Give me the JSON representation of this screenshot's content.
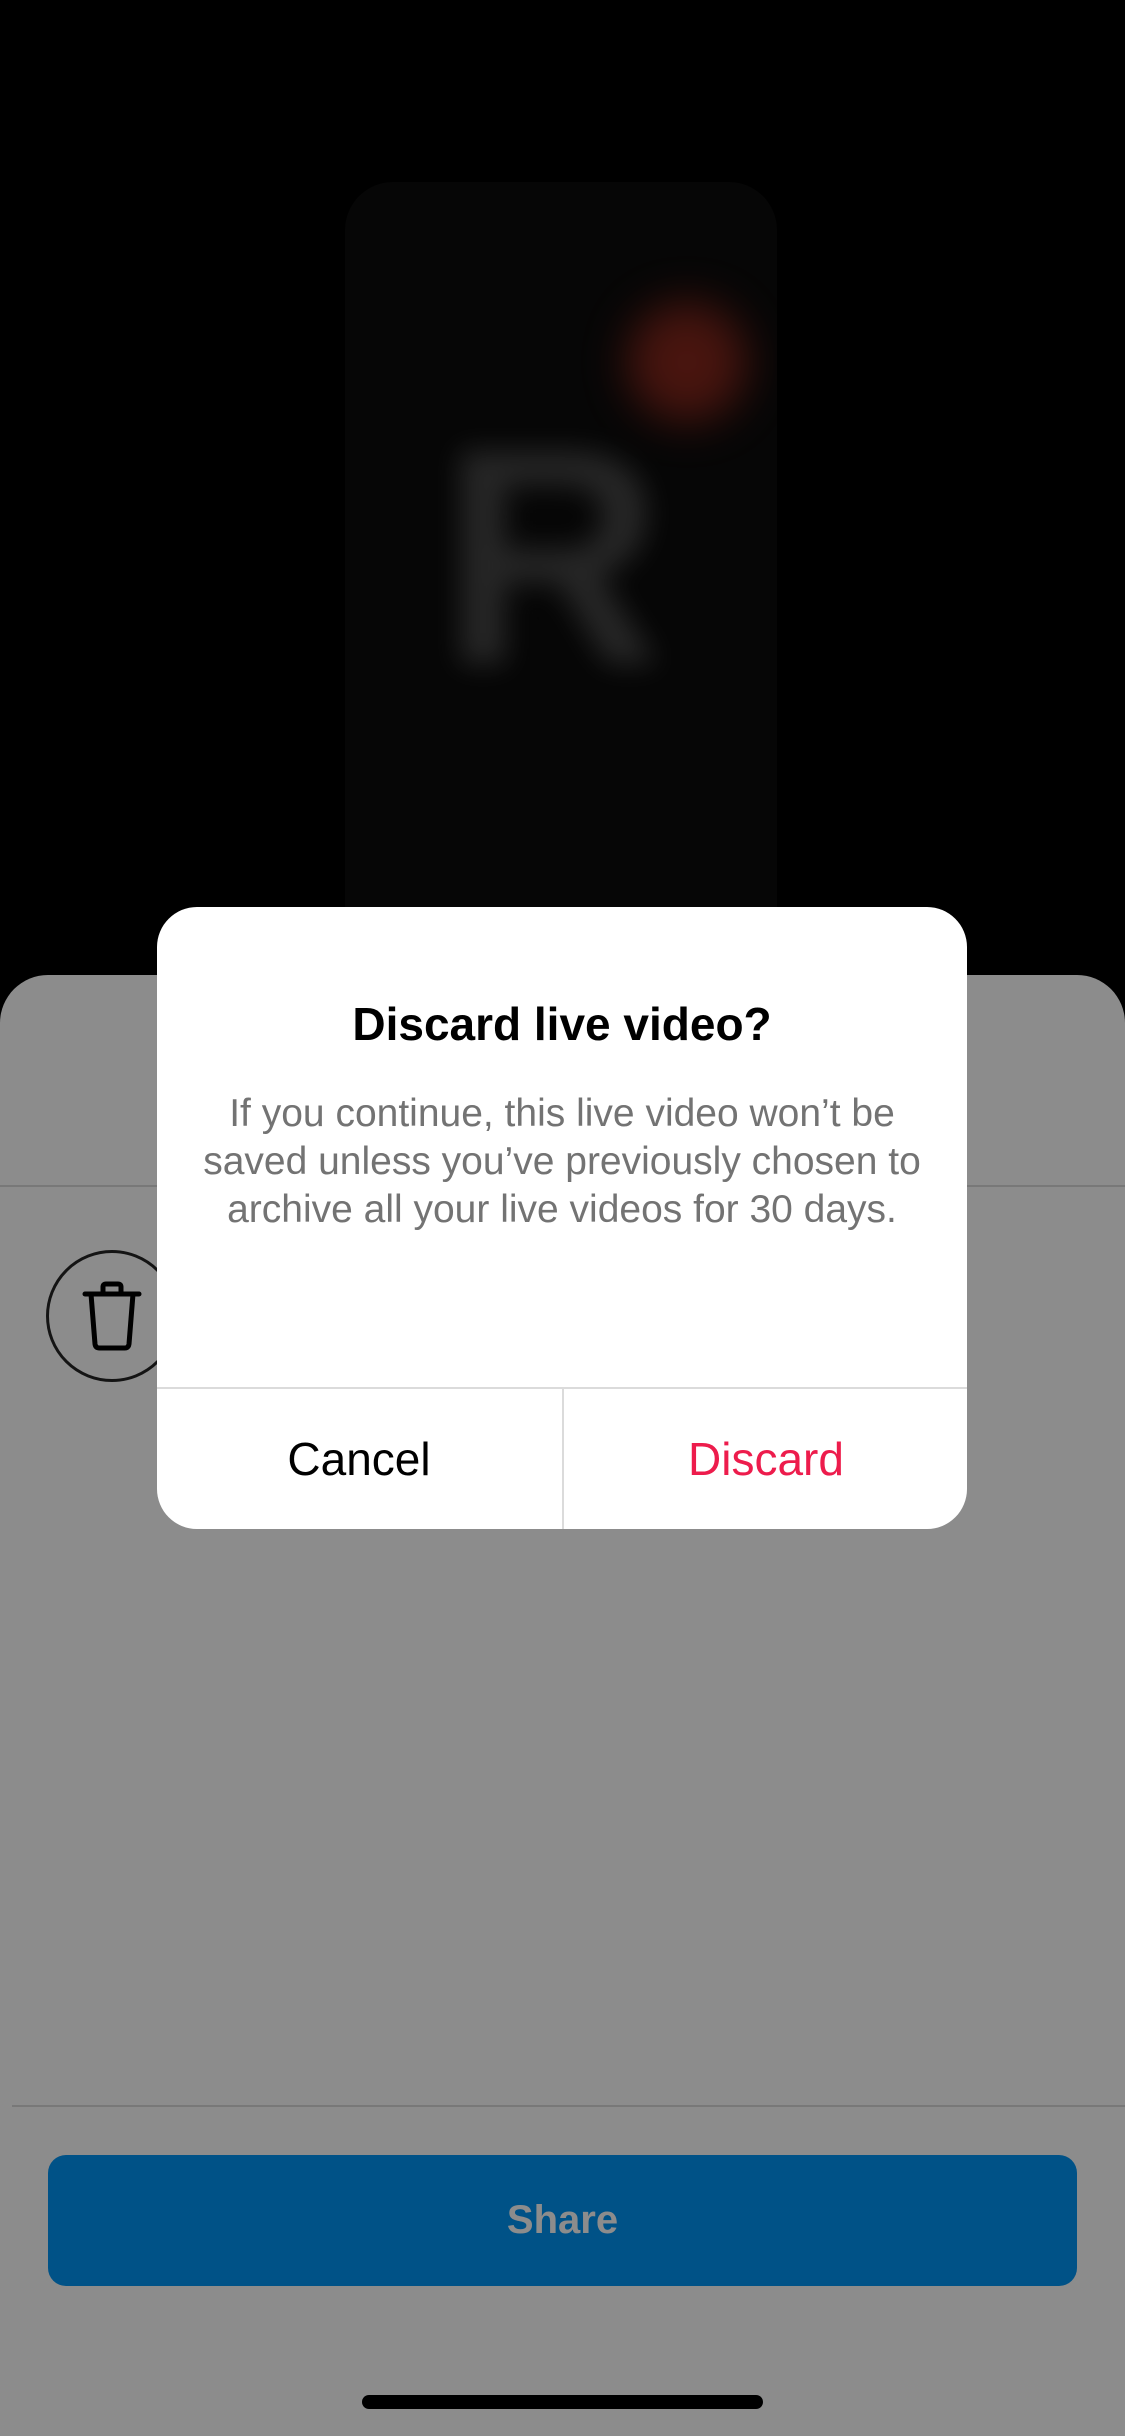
{
  "alert": {
    "title": "Discard live video?",
    "message": "If you continue, this live video won’t be saved unless you’ve previously chosen to archive all your live videos for 30 days.",
    "cancel_label": "Cancel",
    "discard_label": "Discard",
    "discard_color": "#ed1c4c"
  },
  "sheet": {
    "share_label": "Share",
    "share_color": "#0095f6",
    "delete_icon": "trash-icon"
  },
  "preview": {
    "letter": "R"
  }
}
